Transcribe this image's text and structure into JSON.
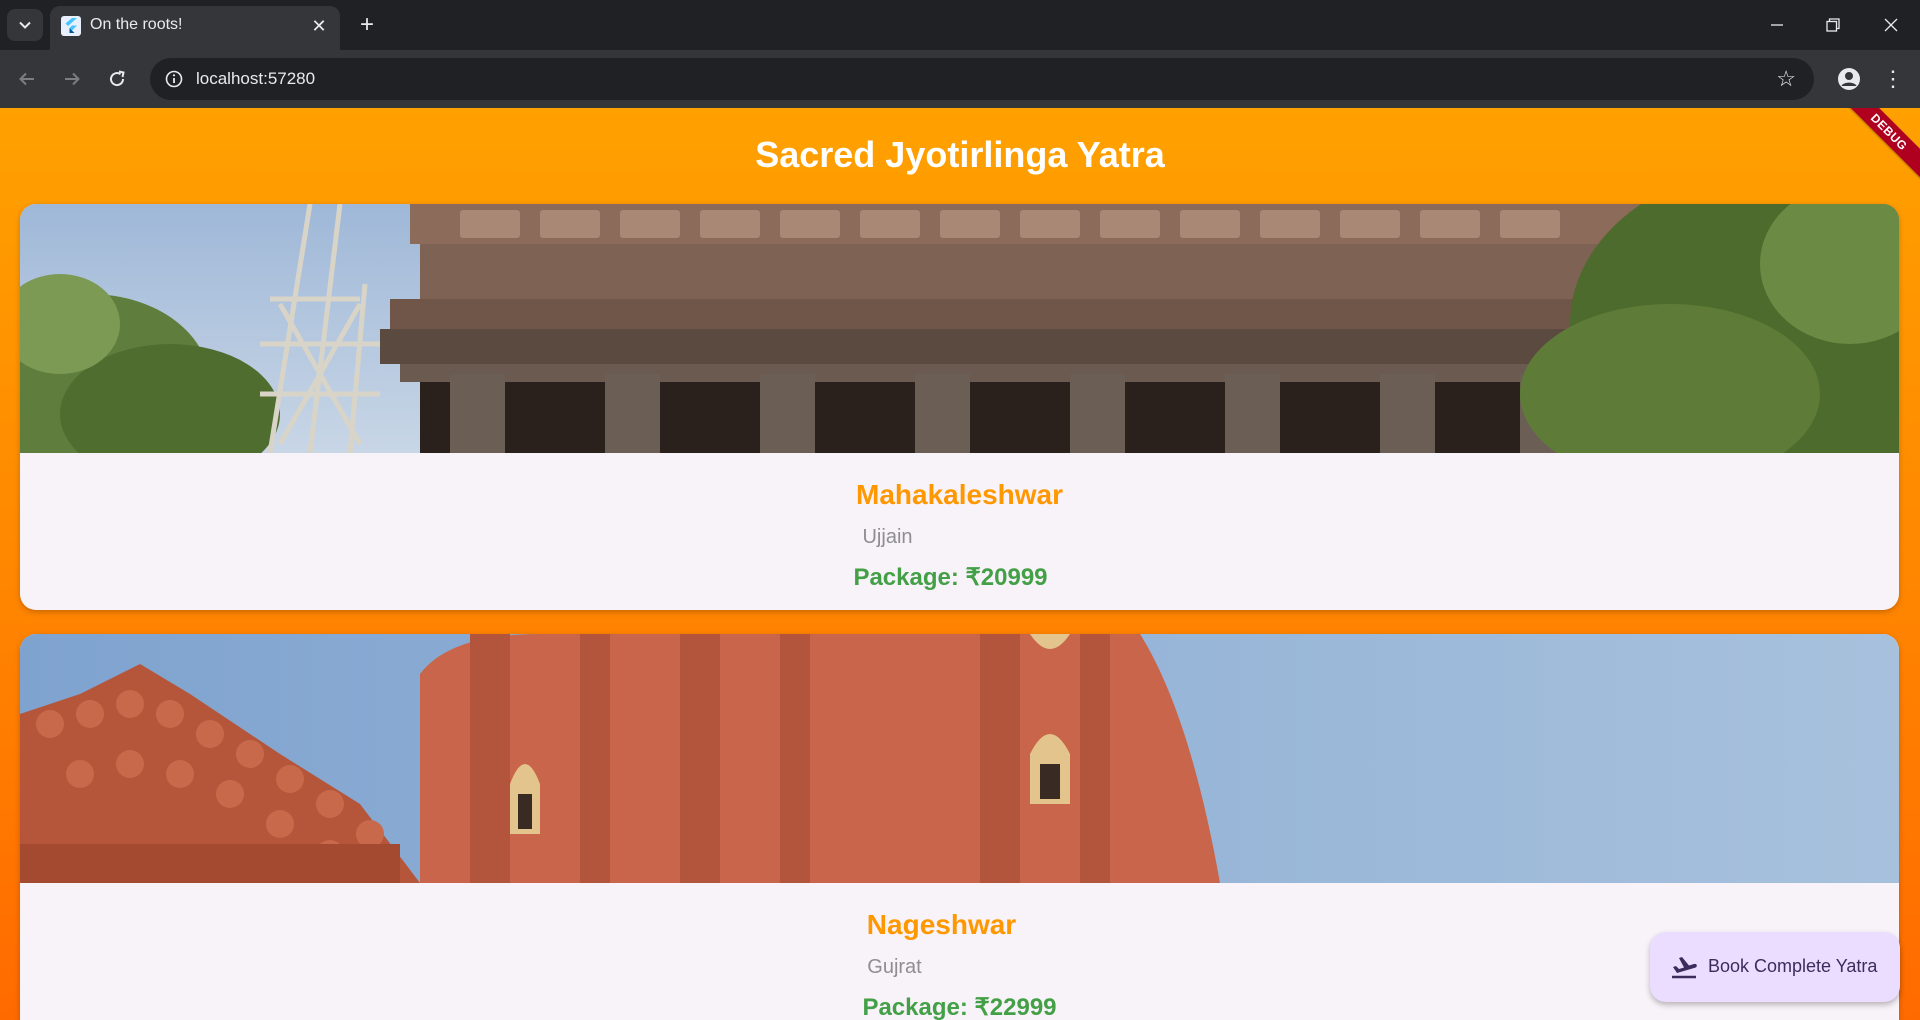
{
  "browser": {
    "tab_title": "On the roots!",
    "url": "localhost:57280"
  },
  "page": {
    "title": "Sacred Jyotirlinga Yatra",
    "debug_banner": "DEBUG",
    "cards": [
      {
        "name": "Mahakaleshwar",
        "city": "Ujjain",
        "price": "Package: ₹20999"
      },
      {
        "name": "Nageshwar",
        "city": "Gujrat",
        "price": "Package: ₹22999"
      }
    ],
    "fab_label": "Book Complete Yatra"
  },
  "colors": {
    "accent_orange": "#ff9800",
    "price_green": "#43a047",
    "gradient_top": "#ffa100",
    "gradient_bottom": "#ff6a00",
    "fab_bg": "#eaddff"
  },
  "icons": {
    "fab": "flight-takeoff-icon"
  }
}
